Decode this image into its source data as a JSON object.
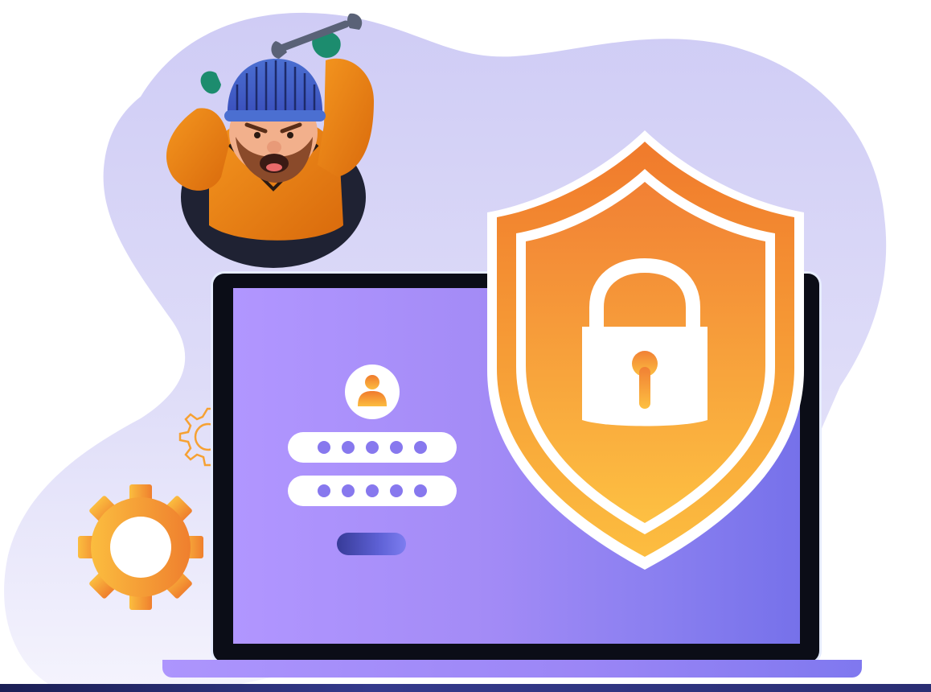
{
  "illustration": {
    "colors": {
      "blob": "#d4d1f6",
      "shield_outer": "#f07a2c",
      "shield_inner_top": "#f17e32",
      "shield_inner_bottom": "#fcbd40",
      "screen_left": "#b196ff",
      "screen_right": "#7671ea",
      "gear": "#f6a133",
      "hoodie": "#ee8a1f",
      "beanie": "#4a6fd0"
    },
    "icons": [
      "shield-icon",
      "padlock-icon",
      "user-icon",
      "gear-icon",
      "wrench-icon"
    ],
    "login_form": {
      "password_fields": [
        {
          "masked_chars": 5
        },
        {
          "masked_chars": 5
        }
      ]
    }
  }
}
